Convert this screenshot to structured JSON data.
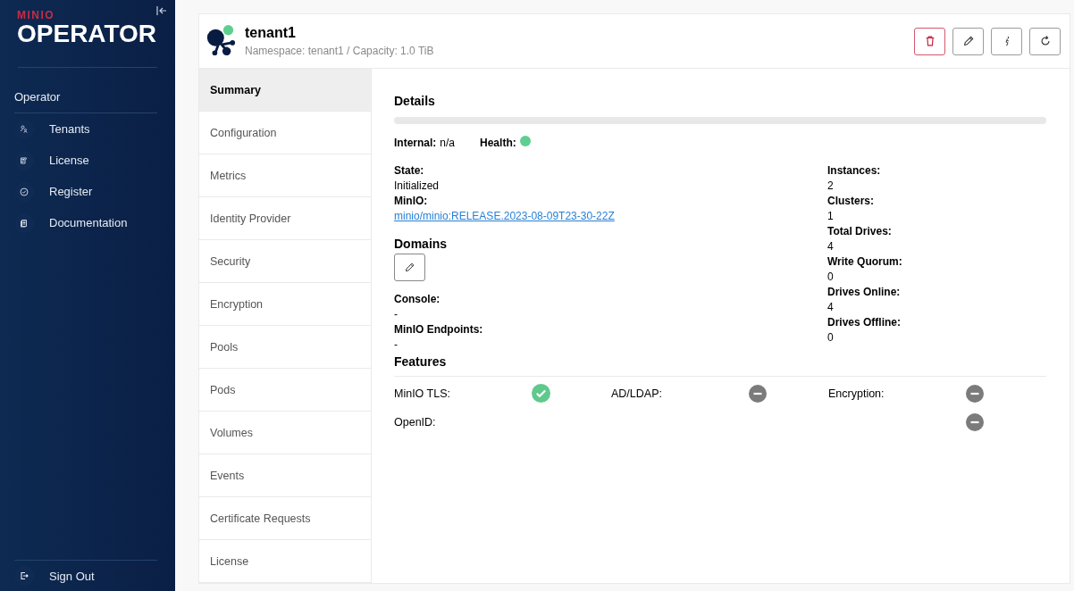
{
  "sidebar": {
    "logo": {
      "brand": "MINIO",
      "product": "OPERATOR"
    },
    "section": "Operator",
    "items": [
      {
        "label": "Tenants",
        "selected": false
      },
      {
        "label": "License",
        "selected": false
      },
      {
        "label": "Register",
        "selected": false
      },
      {
        "label": "Documentation",
        "selected": false
      }
    ],
    "sign_out": "Sign Out"
  },
  "tenant": {
    "name": "tenant1",
    "subtitle": "Namespace: tenant1 / Capacity: 1.0 TiB"
  },
  "tabs": [
    {
      "label": "Summary",
      "selected": true
    },
    {
      "label": "Configuration",
      "selected": false
    },
    {
      "label": "Metrics",
      "selected": false
    },
    {
      "label": "Identity Provider",
      "selected": false
    },
    {
      "label": "Security",
      "selected": false
    },
    {
      "label": "Encryption",
      "selected": false
    },
    {
      "label": "Pools",
      "selected": false
    },
    {
      "label": "Pods",
      "selected": false
    },
    {
      "label": "Volumes",
      "selected": false
    },
    {
      "label": "Events",
      "selected": false
    },
    {
      "label": "Certificate Requests",
      "selected": false
    },
    {
      "label": "License",
      "selected": false
    }
  ],
  "details": {
    "title": "Details",
    "internal": {
      "label": "Internal:",
      "value": "n/a"
    },
    "health": {
      "label": "Health:",
      "color": "#5fcf8f"
    },
    "state": {
      "label": "State:",
      "value": "Initialized"
    },
    "minio": {
      "label": "MinIO:",
      "value": "minio/minio:RELEASE.2023-08-09T23-30-22Z"
    },
    "domains_title": "Domains",
    "console": {
      "label": "Console:",
      "value": "-"
    },
    "endpoints": {
      "label": "MinIO Endpoints:",
      "value": "-"
    },
    "stats": [
      {
        "label": "Instances:",
        "value": "2"
      },
      {
        "label": "Clusters:",
        "value": "1"
      },
      {
        "label": "Total Drives:",
        "value": "4"
      },
      {
        "label": "Write Quorum:",
        "value": "0"
      },
      {
        "label": "Drives Online:",
        "value": "4"
      },
      {
        "label": "Drives Offline:",
        "value": "0"
      }
    ]
  },
  "features": {
    "title": "Features",
    "items": [
      {
        "label": "MinIO TLS:",
        "enabled": true
      },
      {
        "label": "AD/LDAP:",
        "enabled": false
      },
      {
        "label": "Encryption:",
        "enabled": false
      },
      {
        "label": "OpenID:",
        "enabled": false
      }
    ]
  }
}
